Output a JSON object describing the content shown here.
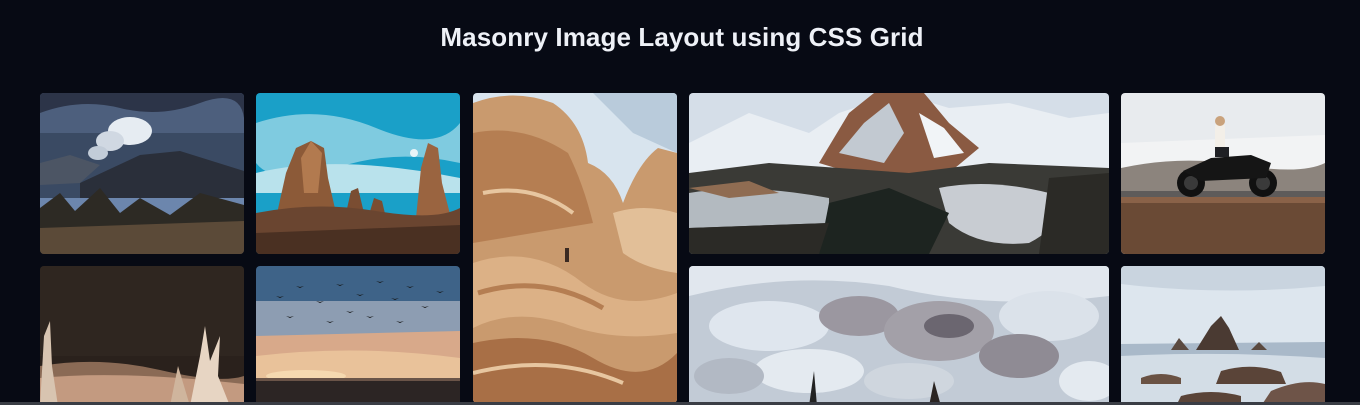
{
  "header": {
    "title": "Masonry Image Layout using CSS Grid"
  },
  "gallery": {
    "images": [
      {
        "name": "volcano-smoke-image"
      },
      {
        "name": "rock-spires-image"
      },
      {
        "name": "sandstone-canyon-image"
      },
      {
        "name": "snowy-mountain-lake-image"
      },
      {
        "name": "motorcycle-rider-image"
      },
      {
        "name": "dry-grass-dusk-image"
      },
      {
        "name": "birds-sunset-image"
      },
      {
        "name": "cloudy-sky-image"
      },
      {
        "name": "sea-rocks-image"
      }
    ]
  },
  "colors": {
    "background": "#070a14",
    "title": "#eef1f7"
  }
}
